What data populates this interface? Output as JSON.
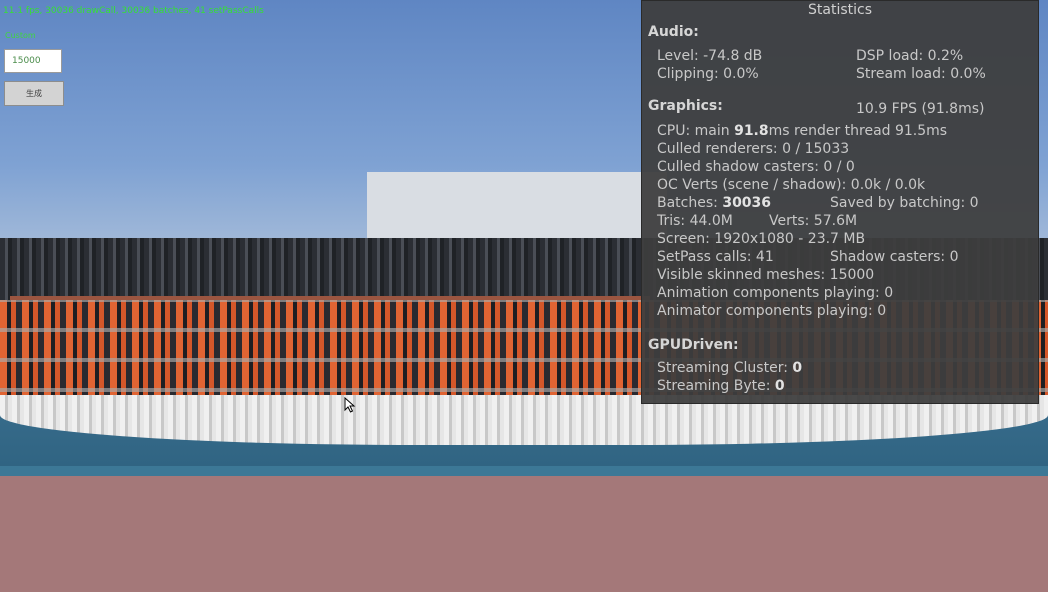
{
  "overlay": {
    "fps_text": "11.1 fps, 30036 drawCall, 30036 batches, 41 setPassCalls",
    "mode_label": "Custom",
    "count_value": "15000",
    "generate_label": "生成"
  },
  "stats": {
    "title": "Statistics",
    "audio": {
      "header": "Audio:",
      "level": "Level: -74.8 dB",
      "dsp_load": "DSP load: 0.2%",
      "clipping": "Clipping: 0.0%",
      "stream_load": "Stream load: 0.0%"
    },
    "graphics": {
      "header": "Graphics:",
      "fps": "10.9 FPS (91.8ms)",
      "cpu_prefix": "CPU: main",
      "cpu_main": "91.8",
      "cpu_suffix": "ms  render thread 91.5ms",
      "culled_renderers": "Culled renderers: 0 / 15033",
      "culled_shadow_casters": "Culled shadow casters: 0 / 0",
      "oc_verts": "OC Verts (scene / shadow): 0.0k / 0.0k",
      "batches_label": "Batches:",
      "batches_value": "30036",
      "saved_by_batching": "Saved by batching: 0",
      "tris": "Tris: 44.0M",
      "verts": "Verts: 57.6M",
      "screen": "Screen: 1920x1080 - 23.7 MB",
      "setpass": "SetPass calls: 41",
      "shadow_casters": "Shadow casters: 0",
      "skinned_meshes": "Visible skinned meshes: 15000",
      "animation_components": "Animation components playing: 0",
      "animator_components": "Animator components playing: 0"
    },
    "gpudriven": {
      "header": "GPUDriven:",
      "streaming_cluster_label": "Streaming Cluster:",
      "streaming_cluster_value": "0",
      "streaming_byte_label": "Streaming Byte:",
      "streaming_byte_value": "0"
    }
  },
  "colors": {
    "fps_text": "#35e035",
    "panel_bg": "#3e3e3e",
    "floor": "#a47879"
  }
}
